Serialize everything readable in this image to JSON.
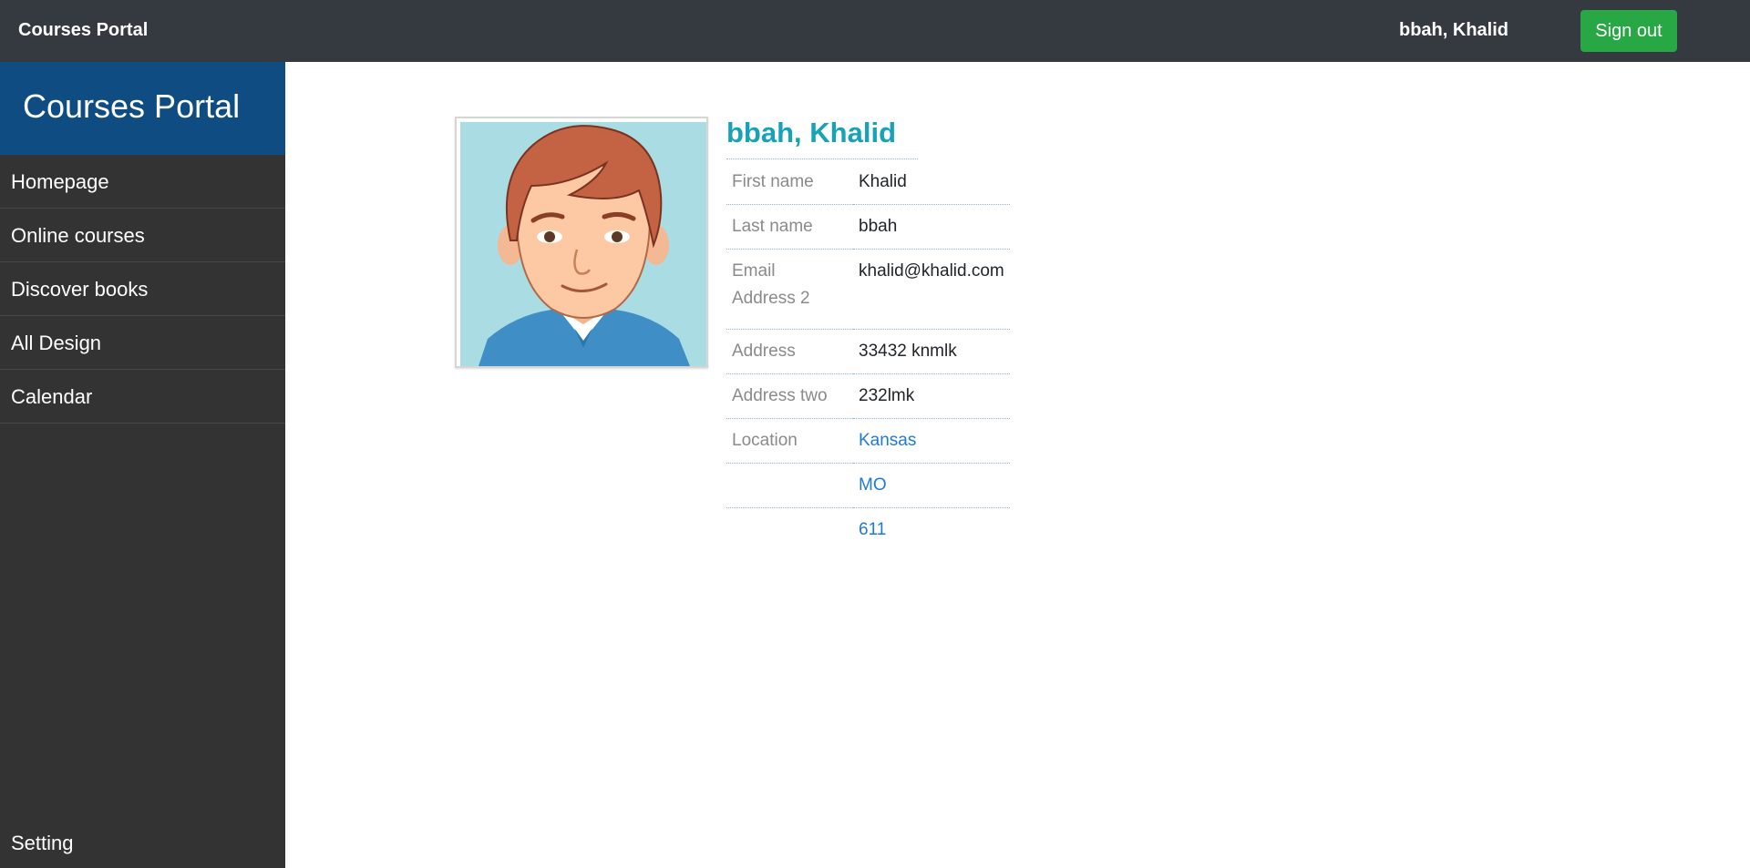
{
  "topbar": {
    "brand": "Courses Portal",
    "user_name": "bbah, Khalid",
    "signout_label": "Sign out"
  },
  "sidebar": {
    "title": "Courses Portal",
    "items": [
      {
        "label": "Homepage"
      },
      {
        "label": "Online courses"
      },
      {
        "label": "Discover books"
      },
      {
        "label": "All Design"
      },
      {
        "label": "Calendar"
      }
    ],
    "setting_label": "Setting"
  },
  "profile": {
    "name": "bbah, Khalid",
    "avatar_icon": "cartoon-man-avatar",
    "fields": {
      "first_name": {
        "label": "First name",
        "value": "Khalid"
      },
      "last_name": {
        "label": "Last name",
        "value": "bbah"
      },
      "email": {
        "label_line1": "Email",
        "label_line2": "Address 2",
        "value": "khalid@khalid.com"
      },
      "address": {
        "label": "Address",
        "value": "33432 knmlk"
      },
      "address_two": {
        "label": "Address two",
        "value": "232lmk"
      },
      "location": {
        "label": "Location",
        "city": "Kansas",
        "state": "MO",
        "zip": "611"
      }
    }
  },
  "colors": {
    "topbar_bg": "#343a40",
    "sidebar_bg": "#333333",
    "sidebar_header_bg": "#0f4c81",
    "signout_bg": "#28a745",
    "name_color": "#17a2b8",
    "link_color": "#1e7ad6"
  }
}
